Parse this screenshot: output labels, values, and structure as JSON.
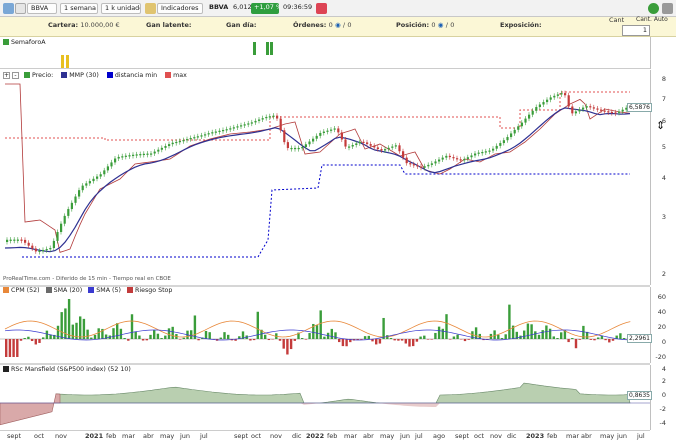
{
  "toolbar": {
    "ticker": "BBVA",
    "period": "1 semana",
    "units": "1 k unidades",
    "indicators": "Indicadores",
    "quote_ticker": "BBVA",
    "quote_price": "6,012",
    "quote_change": "+1,07 %",
    "quote_time": "09:36:59",
    "right_label_1": "Cant",
    "right_label_2": "Cant. Auto",
    "quantity_value": "1"
  },
  "infobar": {
    "cartera_label": "Cartera:",
    "cartera_value": "10.000,00 €",
    "latente_label": "Gan latente:",
    "dia_label": "Gan día:",
    "ordenes_label": "Órdenes:",
    "ordenes_value": "0",
    "ordenes_sep": "/",
    "ordenes_value2": "0",
    "posicion_label": "Posición:",
    "posicion_value": "0",
    "posicion_sep": "/",
    "posicion_value2": "0",
    "exposicion_label": "Exposición:",
    "eye_glyph": "◉"
  },
  "semaforo": {
    "label": "SemaforoA"
  },
  "price_panel": {
    "legend": [
      {
        "label": "Precio: ",
        "color": "#3a9d3a"
      },
      {
        "label": "MMP (30)",
        "color": "#2e3192"
      },
      {
        "label": "distancia min",
        "color": "#0000cc"
      },
      {
        "label": "max",
        "color": "#e05050"
      }
    ],
    "ticks": [
      "8",
      "7",
      "6",
      "5",
      "4",
      "3",
      "2"
    ],
    "price_tag": "6,5876",
    "source_note": "ProRealTime.com - Diferido de 15 min - Tiempo real en CBOE"
  },
  "osc_panel": {
    "legend": [
      {
        "label": "CPM (52)",
        "color": "#e8883a"
      },
      {
        "label": "SMA (20)",
        "color": "#6a6a6a"
      },
      {
        "label": "SMA (5)",
        "color": "#3a3ad0"
      },
      {
        "label": "Riesgo Stop",
        "color": "#c23b3b"
      }
    ],
    "ticks": [
      "60",
      "40",
      "20",
      "0",
      "-20"
    ],
    "value_tag": "2,2961"
  },
  "rsc_panel": {
    "title": "RSc Mansfield (S&P500 index) (52 10)",
    "ticks": [
      "4",
      "2",
      "0",
      "-2",
      "-4"
    ],
    "value_tag": "0,8635"
  },
  "x_axis": [
    {
      "label": "sept",
      "bold": false
    },
    {
      "label": "oct",
      "bold": false
    },
    {
      "label": "nov",
      "bold": false
    },
    {
      "label": "2021",
      "bold": true
    },
    {
      "label": "feb",
      "bold": false
    },
    {
      "label": "mar",
      "bold": false
    },
    {
      "label": "abr",
      "bold": false
    },
    {
      "label": "may",
      "bold": false
    },
    {
      "label": "jun",
      "bold": false
    },
    {
      "label": "jul",
      "bold": false
    },
    {
      "label": "sept",
      "bold": false
    },
    {
      "label": "oct",
      "bold": false
    },
    {
      "label": "nov",
      "bold": false
    },
    {
      "label": "dic",
      "bold": false
    },
    {
      "label": "2022",
      "bold": true
    },
    {
      "label": "feb",
      "bold": false
    },
    {
      "label": "mar",
      "bold": false
    },
    {
      "label": "abr",
      "bold": false
    },
    {
      "label": "may",
      "bold": false
    },
    {
      "label": "jun",
      "bold": false
    },
    {
      "label": "jul",
      "bold": false
    },
    {
      "label": "ago",
      "bold": false
    },
    {
      "label": "sept",
      "bold": false
    },
    {
      "label": "oct",
      "bold": false
    },
    {
      "label": "nov",
      "bold": false
    },
    {
      "label": "dic",
      "bold": false
    },
    {
      "label": "2023",
      "bold": true
    },
    {
      "label": "feb",
      "bold": false
    },
    {
      "label": "mar",
      "bold": false
    },
    {
      "label": "abr",
      "bold": false
    },
    {
      "label": "may",
      "bold": false
    },
    {
      "label": "jun",
      "bold": false
    },
    {
      "label": "jul",
      "bold": false
    }
  ],
  "colors": {
    "up": "#3a9d3a",
    "down": "#c43b3b",
    "mmp": "#2e3192",
    "dist_min": "#0000cc",
    "max": "#e05050",
    "rsc_fill": "#b9cfb0",
    "rsc_neg": "#d9a9a9"
  }
}
